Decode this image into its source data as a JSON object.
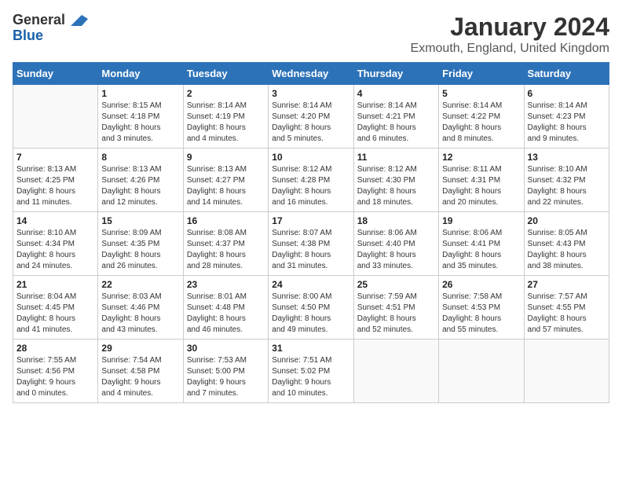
{
  "logo": {
    "line1": "General",
    "line2": "Blue"
  },
  "title": "January 2024",
  "subtitle": "Exmouth, England, United Kingdom",
  "days_of_week": [
    "Sunday",
    "Monday",
    "Tuesday",
    "Wednesday",
    "Thursday",
    "Friday",
    "Saturday"
  ],
  "weeks": [
    [
      {
        "day": "",
        "info": ""
      },
      {
        "day": "1",
        "info": "Sunrise: 8:15 AM\nSunset: 4:18 PM\nDaylight: 8 hours\nand 3 minutes."
      },
      {
        "day": "2",
        "info": "Sunrise: 8:14 AM\nSunset: 4:19 PM\nDaylight: 8 hours\nand 4 minutes."
      },
      {
        "day": "3",
        "info": "Sunrise: 8:14 AM\nSunset: 4:20 PM\nDaylight: 8 hours\nand 5 minutes."
      },
      {
        "day": "4",
        "info": "Sunrise: 8:14 AM\nSunset: 4:21 PM\nDaylight: 8 hours\nand 6 minutes."
      },
      {
        "day": "5",
        "info": "Sunrise: 8:14 AM\nSunset: 4:22 PM\nDaylight: 8 hours\nand 8 minutes."
      },
      {
        "day": "6",
        "info": "Sunrise: 8:14 AM\nSunset: 4:23 PM\nDaylight: 8 hours\nand 9 minutes."
      }
    ],
    [
      {
        "day": "7",
        "info": "Sunrise: 8:13 AM\nSunset: 4:25 PM\nDaylight: 8 hours\nand 11 minutes."
      },
      {
        "day": "8",
        "info": "Sunrise: 8:13 AM\nSunset: 4:26 PM\nDaylight: 8 hours\nand 12 minutes."
      },
      {
        "day": "9",
        "info": "Sunrise: 8:13 AM\nSunset: 4:27 PM\nDaylight: 8 hours\nand 14 minutes."
      },
      {
        "day": "10",
        "info": "Sunrise: 8:12 AM\nSunset: 4:28 PM\nDaylight: 8 hours\nand 16 minutes."
      },
      {
        "day": "11",
        "info": "Sunrise: 8:12 AM\nSunset: 4:30 PM\nDaylight: 8 hours\nand 18 minutes."
      },
      {
        "day": "12",
        "info": "Sunrise: 8:11 AM\nSunset: 4:31 PM\nDaylight: 8 hours\nand 20 minutes."
      },
      {
        "day": "13",
        "info": "Sunrise: 8:10 AM\nSunset: 4:32 PM\nDaylight: 8 hours\nand 22 minutes."
      }
    ],
    [
      {
        "day": "14",
        "info": "Sunrise: 8:10 AM\nSunset: 4:34 PM\nDaylight: 8 hours\nand 24 minutes."
      },
      {
        "day": "15",
        "info": "Sunrise: 8:09 AM\nSunset: 4:35 PM\nDaylight: 8 hours\nand 26 minutes."
      },
      {
        "day": "16",
        "info": "Sunrise: 8:08 AM\nSunset: 4:37 PM\nDaylight: 8 hours\nand 28 minutes."
      },
      {
        "day": "17",
        "info": "Sunrise: 8:07 AM\nSunset: 4:38 PM\nDaylight: 8 hours\nand 31 minutes."
      },
      {
        "day": "18",
        "info": "Sunrise: 8:06 AM\nSunset: 4:40 PM\nDaylight: 8 hours\nand 33 minutes."
      },
      {
        "day": "19",
        "info": "Sunrise: 8:06 AM\nSunset: 4:41 PM\nDaylight: 8 hours\nand 35 minutes."
      },
      {
        "day": "20",
        "info": "Sunrise: 8:05 AM\nSunset: 4:43 PM\nDaylight: 8 hours\nand 38 minutes."
      }
    ],
    [
      {
        "day": "21",
        "info": "Sunrise: 8:04 AM\nSunset: 4:45 PM\nDaylight: 8 hours\nand 41 minutes."
      },
      {
        "day": "22",
        "info": "Sunrise: 8:03 AM\nSunset: 4:46 PM\nDaylight: 8 hours\nand 43 minutes."
      },
      {
        "day": "23",
        "info": "Sunrise: 8:01 AM\nSunset: 4:48 PM\nDaylight: 8 hours\nand 46 minutes."
      },
      {
        "day": "24",
        "info": "Sunrise: 8:00 AM\nSunset: 4:50 PM\nDaylight: 8 hours\nand 49 minutes."
      },
      {
        "day": "25",
        "info": "Sunrise: 7:59 AM\nSunset: 4:51 PM\nDaylight: 8 hours\nand 52 minutes."
      },
      {
        "day": "26",
        "info": "Sunrise: 7:58 AM\nSunset: 4:53 PM\nDaylight: 8 hours\nand 55 minutes."
      },
      {
        "day": "27",
        "info": "Sunrise: 7:57 AM\nSunset: 4:55 PM\nDaylight: 8 hours\nand 57 minutes."
      }
    ],
    [
      {
        "day": "28",
        "info": "Sunrise: 7:55 AM\nSunset: 4:56 PM\nDaylight: 9 hours\nand 0 minutes."
      },
      {
        "day": "29",
        "info": "Sunrise: 7:54 AM\nSunset: 4:58 PM\nDaylight: 9 hours\nand 4 minutes."
      },
      {
        "day": "30",
        "info": "Sunrise: 7:53 AM\nSunset: 5:00 PM\nDaylight: 9 hours\nand 7 minutes."
      },
      {
        "day": "31",
        "info": "Sunrise: 7:51 AM\nSunset: 5:02 PM\nDaylight: 9 hours\nand 10 minutes."
      },
      {
        "day": "",
        "info": ""
      },
      {
        "day": "",
        "info": ""
      },
      {
        "day": "",
        "info": ""
      }
    ]
  ]
}
